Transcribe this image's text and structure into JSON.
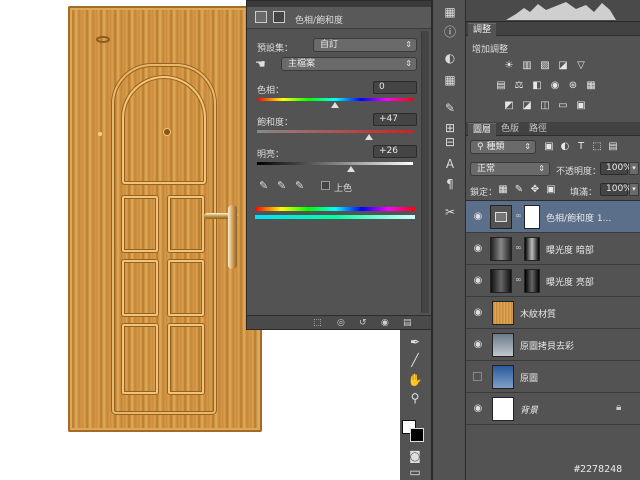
{
  "dialog": {
    "title": "色相/飽和度",
    "preset_label": "預設集：",
    "preset_value": "自訂",
    "channel_value": "主檔案",
    "hue_label": "色相：",
    "hue_value": "0",
    "saturation_label": "飽和度：",
    "saturation_value": "+47",
    "lightness_label": "明亮：",
    "lightness_value": "+26",
    "colorize_label": "上色",
    "hue_level": 0.5,
    "saturation_level": 0.72,
    "lightness_level": 0.6
  },
  "adjustments": {
    "tab_label": "調整",
    "title": "增加調整"
  },
  "layers_panel": {
    "tabs": [
      "圖層",
      "色版",
      "路徑"
    ],
    "filter_label": "種類",
    "blend_mode": "正常",
    "opacity_label": "不透明度：",
    "opacity_value": "100%",
    "lock_label": "鎖定：",
    "fill_label": "填滿：",
    "fill_value": "100%",
    "layers": [
      {
        "name": "色相/飽和度 1...",
        "selected": true,
        "visible": true
      },
      {
        "name": "曝光度 暗部",
        "selected": false,
        "visible": true
      },
      {
        "name": "曝光度 亮部",
        "selected": false,
        "visible": true
      },
      {
        "name": "木紋材質",
        "selected": false,
        "visible": true
      },
      {
        "name": "原圖拷貝去彩",
        "selected": false,
        "visible": true
      },
      {
        "name": "原圖",
        "selected": false,
        "visible": false
      },
      {
        "name": "背景",
        "selected": false,
        "visible": true
      }
    ]
  },
  "watermark": "#2278248",
  "colors": {
    "panel_bg": "#535353",
    "selected_layer": "#5b6e8a",
    "door_wood": "#d9a24f"
  }
}
